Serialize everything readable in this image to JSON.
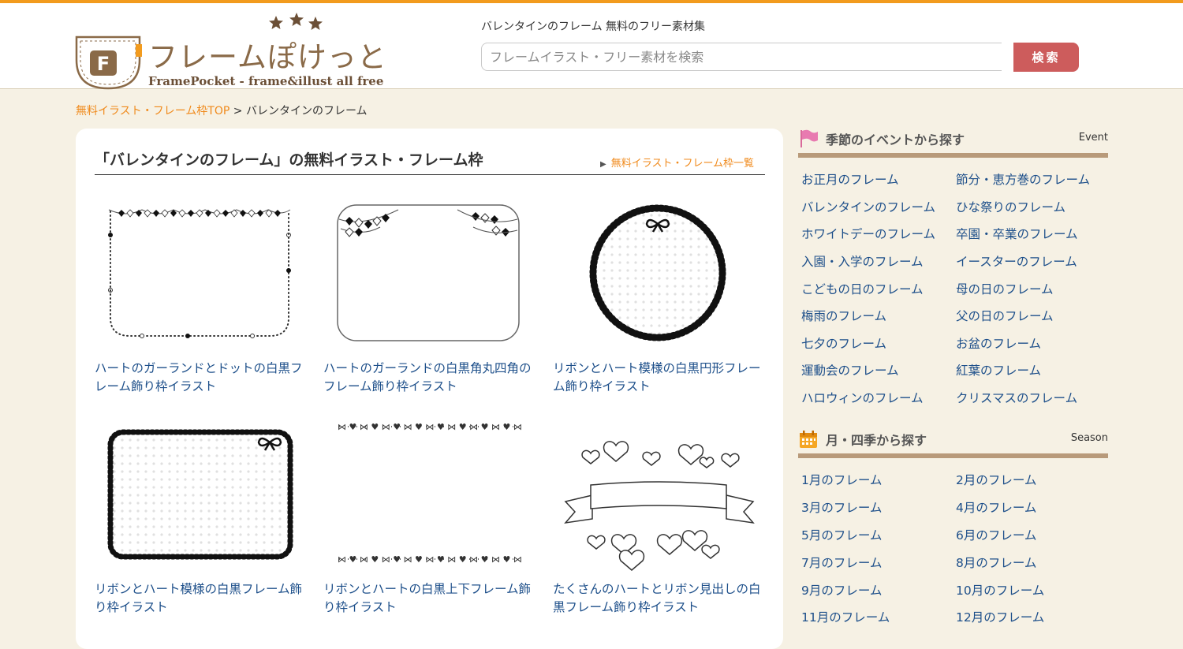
{
  "header": {
    "logo_title": "フレームぽけっと",
    "logo_sub": "FramePocket - frame&illust all free",
    "logo_badge": "F",
    "tagline": "バレンタインのフレーム 無料のフリー素材集",
    "search_placeholder": "フレームイラスト・フリー素材を検索",
    "search_button": "検索"
  },
  "breadcrumb": {
    "home": "無料イラスト・フレーム枠TOP",
    "separator": ">",
    "current": "バレンタインのフレーム"
  },
  "main": {
    "title": "「バレンタインのフレーム」の無料イラスト・フレーム枠",
    "list_link": "無料イラスト・フレーム枠一覧",
    "items": [
      {
        "caption": "ハートのガーランドとドットの白黒フレーム飾り枠イラスト"
      },
      {
        "caption": "ハートのガーランドの白黒角丸四角のフレーム飾り枠イラスト"
      },
      {
        "caption": "リボンとハート模様の白黒円形フレーム飾り枠イラスト"
      },
      {
        "caption": "リボンとハート模様の白黒フレーム飾り枠イラスト"
      },
      {
        "caption": "リボンとハートの白黒上下フレーム飾り枠イラスト"
      },
      {
        "caption": "たくさんのハートとリボン見出しの白黒フレーム飾り枠イラスト"
      }
    ]
  },
  "sidebar": {
    "event": {
      "title": "季節のイベントから探す",
      "tag": "Event",
      "icon": "flag-icon",
      "links": [
        "お正月のフレーム",
        "節分・恵方巻のフレーム",
        "バレンタインのフレーム",
        "ひな祭りのフレーム",
        "ホワイトデーのフレーム",
        "卒園・卒業のフレーム",
        "入園・入学のフレーム",
        "イースターのフレーム",
        "こどもの日のフレーム",
        "母の日のフレーム",
        "梅雨のフレーム",
        "父の日のフレーム",
        "七夕のフレーム",
        "お盆のフレーム",
        "運動会のフレーム",
        "紅葉のフレーム",
        "ハロウィンのフレーム",
        "クリスマスのフレーム"
      ]
    },
    "season": {
      "title": "月・四季から探す",
      "tag": "Season",
      "icon": "calendar-icon",
      "links": [
        "1月のフレーム",
        "2月のフレーム",
        "3月のフレーム",
        "4月のフレーム",
        "5月のフレーム",
        "6月のフレーム",
        "7月のフレーム",
        "8月のフレーム",
        "9月のフレーム",
        "10月のフレーム",
        "11月のフレーム",
        "12月のフレーム"
      ]
    }
  },
  "colors": {
    "accent_orange": "#f08a1c",
    "link_blue": "#1d4f8a",
    "search_red": "#cd5c5c",
    "page_bg": "#f6f1e4",
    "rule_brown": "#b89a7a"
  }
}
